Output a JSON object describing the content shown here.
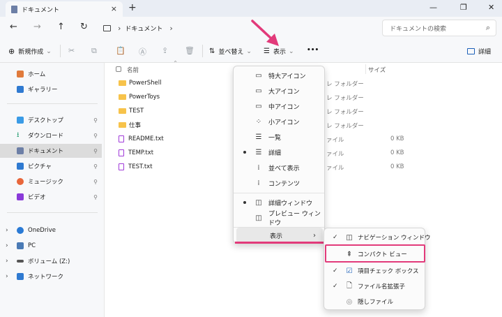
{
  "window": {
    "tab_title": "ドキュメント",
    "tab_close": "×",
    "new_tab": "+",
    "minimize": "—",
    "maximize": "❐",
    "close": "✕"
  },
  "nav": {
    "back": "←",
    "forward": "→",
    "up": "↑",
    "refresh": "↻",
    "breadcrumb": [
      "ドキュメント"
    ],
    "breadcrumb_sep": "›",
    "search_placeholder": "ドキュメントの検索",
    "search_icon": "⌕"
  },
  "toolbar": {
    "new_label": "新規作成",
    "new_icon": "⊕",
    "sort_label": "並べ替え",
    "view_label": "表示",
    "more": "•••",
    "details_label": "詳細",
    "dropdown_caret": "⌄"
  },
  "sidebar": {
    "items": [
      {
        "label": "ホーム",
        "color": "#e07a3b"
      },
      {
        "label": "ギャラリー",
        "color": "#2f7ad1"
      },
      {
        "label": "デスクトップ",
        "color": "#3a9be6",
        "pinned": true
      },
      {
        "label": "ダウンロード",
        "color": "#1f9a6e",
        "pinned": true
      },
      {
        "label": "ドキュメント",
        "color": "#6d7fa6",
        "pinned": true,
        "selected": true
      },
      {
        "label": "ピクチャ",
        "color": "#2f7ad1",
        "pinned": true
      },
      {
        "label": "ミュージック",
        "color": "#e8663a",
        "pinned": true
      },
      {
        "label": "ビデオ",
        "color": "#8a3ad9",
        "pinned": true
      },
      {
        "label": "OneDrive",
        "color": "#2a7ad5"
      },
      {
        "label": "PC",
        "color": "#4a7ab5"
      },
      {
        "label": "ボリューム (Z:)",
        "color": "#555555"
      },
      {
        "label": "ネットワーク",
        "color": "#2f7ad1"
      }
    ],
    "pin_icon": "📌",
    "expand_icon": "›"
  },
  "content": {
    "col_name": "名前",
    "col_size": "サイズ",
    "files": [
      {
        "name": "PowerShell",
        "kind": "folder",
        "type": "レ フォルダー",
        "size": ""
      },
      {
        "name": "PowerToys",
        "kind": "folder",
        "type": "レ フォルダー",
        "size": ""
      },
      {
        "name": "TEST",
        "kind": "folder",
        "type": "レ フォルダー",
        "size": ""
      },
      {
        "name": "仕事",
        "kind": "folder",
        "type": "レ フォルダー",
        "size": ""
      },
      {
        "name": "README.txt",
        "kind": "txt",
        "type": "ァイル",
        "size": "0 KB"
      },
      {
        "name": "TEMP.txt",
        "kind": "txt",
        "type": "ァイル",
        "size": "0 KB"
      },
      {
        "name": "TEST.txt",
        "kind": "txt",
        "type": "ァイル",
        "size": "0 KB"
      }
    ]
  },
  "view_menu": {
    "items": [
      {
        "label": "特大アイコン",
        "icon": "▭"
      },
      {
        "label": "大アイコン",
        "icon": "▭"
      },
      {
        "label": "中アイコン",
        "icon": "▭"
      },
      {
        "label": "小アイコン",
        "icon": "⁘"
      },
      {
        "label": "一覧",
        "icon": "☰"
      },
      {
        "label": "詳細",
        "icon": "☰",
        "selected": true
      },
      {
        "label": "並べて表示",
        "icon": "⁞"
      },
      {
        "label": "コンテンツ",
        "icon": "⁞"
      },
      {
        "label": "詳細ウィンドウ",
        "icon": "◫",
        "selected": true
      },
      {
        "label": "プレビュー ウィンドウ",
        "icon": "◫"
      },
      {
        "label": "表示",
        "arrow": "›"
      }
    ]
  },
  "show_submenu": {
    "items": [
      {
        "label": "ナビゲーション ウィンドウ",
        "icon": "◫",
        "checked": true
      },
      {
        "label": "コンパクト ビュー",
        "icon": "⇞",
        "checked": false
      },
      {
        "label": "項目チェック ボックス",
        "icon": "☑",
        "checked": true
      },
      {
        "label": "ファイル名拡張子",
        "icon": "🗋",
        "checked": true
      },
      {
        "label": "隠しファイル",
        "icon": "◎",
        "checked": false
      }
    ],
    "check_mark": "✓"
  },
  "colors": {
    "highlight": "#e23a7a",
    "folder": "#f7c34b",
    "selected_row": "#dcdcdc"
  }
}
